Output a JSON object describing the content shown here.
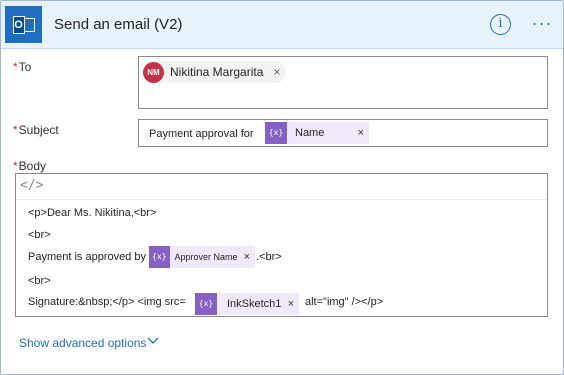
{
  "header": {
    "title": "Send an email (V2)",
    "info_glyph": "i",
    "more_glyph": "···",
    "app_icon": "outlook-icon",
    "app_icon_letter": "O"
  },
  "to": {
    "label": "To",
    "required_mark": "*",
    "recipient": {
      "initials": "NM",
      "name": "Nikitina Margarita",
      "remove": "×",
      "avatar_color": "#c4314b"
    }
  },
  "subject": {
    "label": "Subject",
    "required_mark": "*",
    "text": "Payment approval  for",
    "token": {
      "icon": "{x}",
      "label": "Name",
      "remove": "×"
    }
  },
  "body": {
    "label": "Body",
    "required_mark": "*",
    "toolbar_icon": "</>",
    "line1": "<p>Dear Ms. Nikitina,<br>",
    "line2": "<br>",
    "line3_prefix": "Payment is approved by",
    "line3_token": {
      "icon": "{x}",
      "label": "Approver Name",
      "remove": "×"
    },
    "line3_suffix": ".<br>",
    "line4": "<br>",
    "line5_prefix": "Signature:&nbsp;</p> <img src=",
    "line5_token": {
      "icon": "{x}",
      "label": "InkSketch1",
      "remove": "×"
    },
    "line5_suffix": "alt=\"img\" /></p>"
  },
  "footer": {
    "advanced_label": "Show advanced options"
  },
  "colors": {
    "accent": "#1f6ec1",
    "header_bg": "#e8f2fa",
    "token_icon": "#8661c5",
    "token_bg": "#efe9fb",
    "required": "#c4314b"
  }
}
